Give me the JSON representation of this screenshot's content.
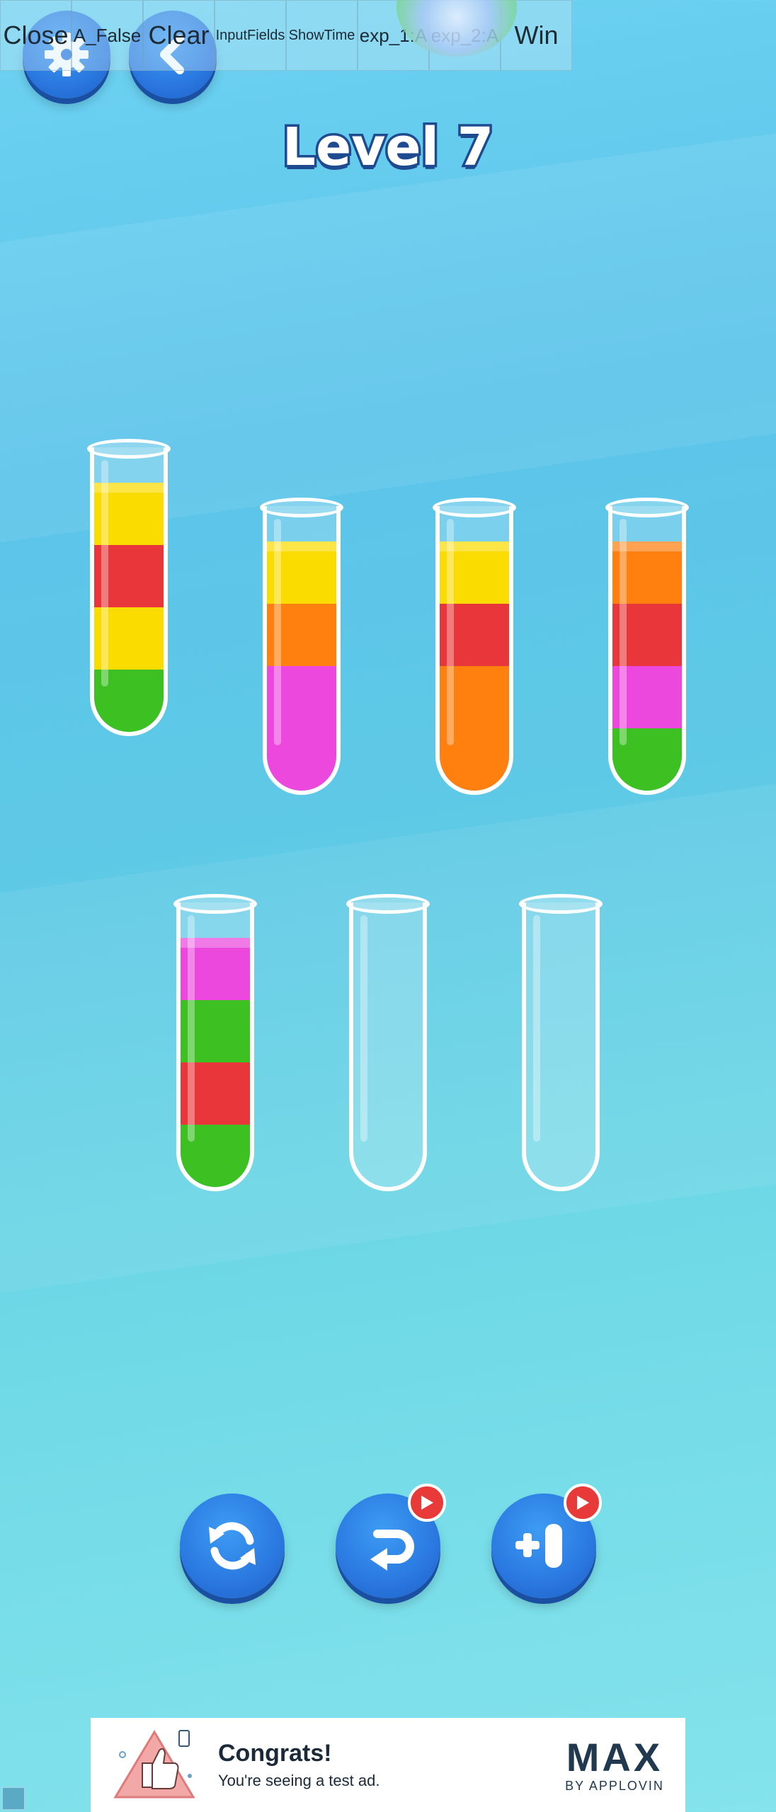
{
  "debug_bar": [
    {
      "label": "Close",
      "size": "big"
    },
    {
      "label": "A_False",
      "size": "mid"
    },
    {
      "label": "Clear",
      "size": "big"
    },
    {
      "label": "InputFields",
      "size": "small"
    },
    {
      "label": "ShowTime",
      "size": "small"
    },
    {
      "label": "exp_1:A",
      "size": "mid"
    },
    {
      "label": "exp_2:A",
      "size": "mid"
    },
    {
      "label": "Win",
      "size": "big"
    }
  ],
  "level_title": "Level 7",
  "colors": {
    "yellow": "#fbdc00",
    "red": "#e8363a",
    "green": "#3cc022",
    "orange": "#ff7f0f",
    "pink": "#ec48dd",
    "button_blue": "#2a78e0",
    "badge_red": "#e93a3a"
  },
  "tubes": [
    {
      "id": "tube-1",
      "layers_top_to_bottom": [
        "yellow",
        "red",
        "yellow",
        "green"
      ]
    },
    {
      "id": "tube-2",
      "layers_top_to_bottom": [
        "yellow",
        "orange",
        "pink",
        "pink"
      ]
    },
    {
      "id": "tube-3",
      "layers_top_to_bottom": [
        "yellow",
        "red",
        "orange",
        "orange"
      ]
    },
    {
      "id": "tube-4",
      "layers_top_to_bottom": [
        "orange",
        "red",
        "pink",
        "green"
      ]
    },
    {
      "id": "tube-5",
      "layers_top_to_bottom": [
        "pink",
        "green",
        "red",
        "green"
      ]
    },
    {
      "id": "tube-6",
      "layers_top_to_bottom": []
    },
    {
      "id": "tube-7",
      "layers_top_to_bottom": []
    }
  ],
  "actions": [
    {
      "name": "restart",
      "icon": "refresh-icon",
      "video_badge": false
    },
    {
      "name": "undo",
      "icon": "undo-icon",
      "video_badge": true
    },
    {
      "name": "add-tube",
      "icon": "add-tube-icon",
      "video_badge": true
    }
  ],
  "ad": {
    "headline": "Congrats!",
    "body": "You're seeing a test ad.",
    "brand": "MAX",
    "brand_sub": "BY APPLOVIN"
  }
}
